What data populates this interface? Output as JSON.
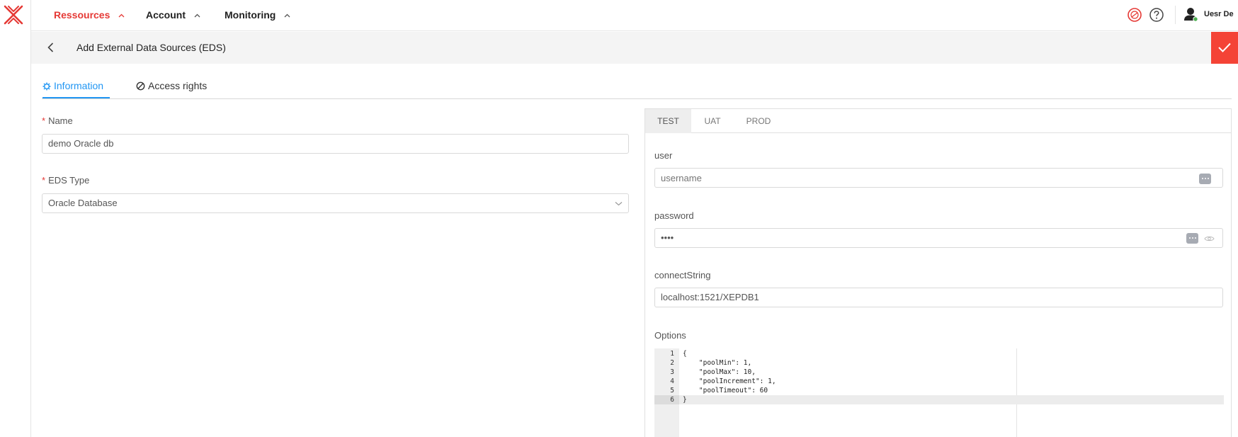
{
  "nav": {
    "items": [
      {
        "label": "Ressources",
        "active": true
      },
      {
        "label": "Account",
        "active": false
      },
      {
        "label": "Monitoring",
        "active": false
      }
    ],
    "user_name": "Uesr De"
  },
  "page": {
    "title": "Add External Data Sources (EDS)"
  },
  "tabs": [
    {
      "label": "Information",
      "icon": "gear-icon",
      "active": true
    },
    {
      "label": "Access rights",
      "icon": "block-icon",
      "active": false
    }
  ],
  "form": {
    "name_label": "Name",
    "name_value": "demo Oracle db",
    "type_label": "EDS Type",
    "type_value": "Oracle Database",
    "required_mark": "*"
  },
  "env": {
    "tabs": [
      "TEST",
      "UAT",
      "PROD"
    ],
    "active_tab": "TEST",
    "user_label": "user",
    "user_placeholder": "username",
    "password_label": "password",
    "password_value": "••••",
    "connect_label": "connectString",
    "connect_value": "localhost:1521/XEPDB1",
    "options_label": "Options",
    "code_lines": [
      "{",
      "    \"poolMin\": 1,",
      "    \"poolMax\": 10,",
      "    \"poolIncrement\": 1,",
      "    \"poolTimeout\": 60",
      "}"
    ],
    "line_numbers": [
      "1",
      "2",
      "3",
      "4",
      "5",
      "6"
    ]
  },
  "colors": {
    "accent_red": "#e53935",
    "accent_blue": "#2196f3",
    "save_button": "#f44336",
    "status_online": "#4caf50"
  }
}
